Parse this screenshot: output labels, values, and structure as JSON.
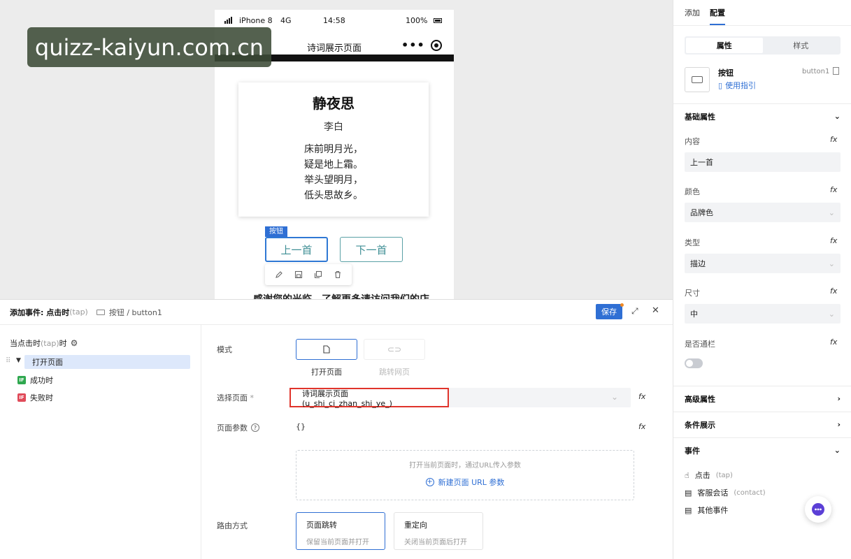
{
  "watermark": "quizz-kaiyun.com.cn",
  "phone": {
    "carrier": "iPhone 8",
    "network": "4G",
    "time": "14:58",
    "battery": "100%",
    "nav_title": "诗词展示页面",
    "poem": {
      "title": "静夜思",
      "author": "李白",
      "lines": [
        "床前明月光，",
        "疑是地上霜。",
        "举头望明月，",
        "低头思故乡。"
      ]
    },
    "btn_tag": "按钮",
    "prev_btn": "上一首",
    "next_btn": "下一首",
    "cut_text": "感谢您的光临，了解更多请访问我们的店"
  },
  "right_panel": {
    "tabs": [
      "添加",
      "配置"
    ],
    "active_tab": "配置",
    "seg": [
      "属性",
      "样式"
    ],
    "component_name": "按钮",
    "component_id": "button1",
    "guide_link": "使用指引",
    "basic_section": "基础属性",
    "fields": {
      "content_label": "内容",
      "content_value": "上一首",
      "color_label": "颜色",
      "color_value": "品牌色",
      "type_label": "类型",
      "type_value": "描边",
      "size_label": "尺寸",
      "size_value": "中",
      "block_label": "是否通栏"
    },
    "fx": "fx",
    "advanced_section": "高级属性",
    "condition_section": "条件展示",
    "events_section": "事件",
    "events": [
      {
        "label": "点击",
        "sub": "(tap)"
      },
      {
        "label": "客服会话",
        "sub": "(contact)"
      },
      {
        "label": "其他事件",
        "sub": ""
      }
    ]
  },
  "bottom_panel": {
    "title": "添加事件: 点击时",
    "title_sub": "(tap)",
    "breadcrumb": "按钮 / button1",
    "save": "保存",
    "tree_root": "当点击时",
    "tree_root_sub": "(tap)",
    "tree_root_suffix": "时",
    "tree_items": [
      "打开页面",
      "成功时",
      "失败时"
    ],
    "if_badge": "IF",
    "mode_label": "模式",
    "mode_options": [
      "打开页面",
      "跳转网页"
    ],
    "select_page_label": "选择页面",
    "required_mark": "*",
    "select_page_value": "诗词展示页面(u_shi_ci_zhan_shi_ye_)",
    "page_params_label": "页面参数",
    "page_params_value": "{}",
    "params_hint": "打开当前页面时，通过URL传入参数",
    "new_param": "新建页面 URL 参数",
    "route_label": "路由方式",
    "routes": [
      {
        "title": "页面跳转",
        "desc": "保留当前页面并打开"
      },
      {
        "title": "重定向",
        "desc": "关闭当前页面后打开"
      }
    ]
  },
  "colors": {
    "accent": "#2f6fd4",
    "highlight_red": "#e0342b",
    "button_teal": "#3f8f95"
  }
}
